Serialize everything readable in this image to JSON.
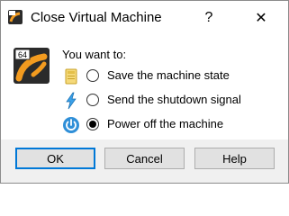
{
  "window": {
    "title": "Close Virtual Machine",
    "help_glyph": "?",
    "close_glyph": "✕"
  },
  "app_icon": {
    "badge": "64"
  },
  "prompt": "You want to:",
  "options": [
    {
      "label": "Save the machine state",
      "icon": "save-state-icon",
      "selected": false
    },
    {
      "label": "Send the shutdown signal",
      "icon": "shutdown-signal-icon",
      "selected": false
    },
    {
      "label": "Power off the machine",
      "icon": "power-off-icon",
      "selected": true
    }
  ],
  "buttons": {
    "ok": "OK",
    "cancel": "Cancel",
    "help": "Help"
  },
  "colors": {
    "accent": "#0078d7",
    "icon_orange": "#f39b1f",
    "icon_dark": "#2b2b2b"
  }
}
